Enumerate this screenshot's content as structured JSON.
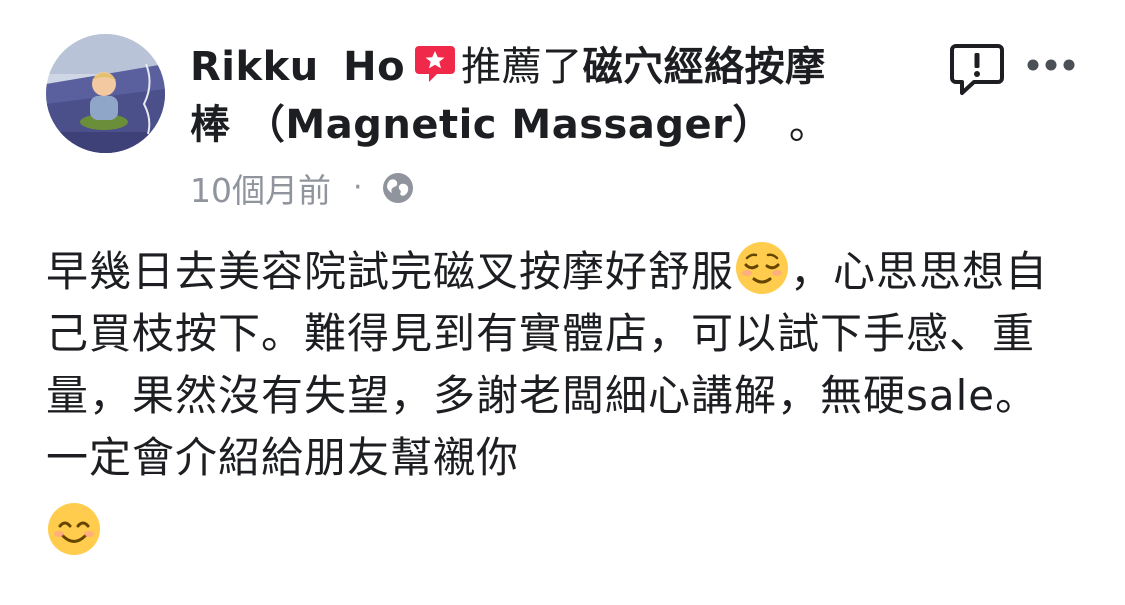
{
  "post": {
    "author": "Rikku  Ho",
    "action": "推薦了",
    "page_name_line1": "磁穴經絡按摩",
    "page_name_line2": "棒 （Magnetic Massager）",
    "trailing": "。",
    "timestamp": "10個月前",
    "separator": "·",
    "body": {
      "part1": "早幾日去美容院試完磁叉按摩好舒服",
      "emoji1": "relieved-face",
      "part2": "，心思思想自己買枝按下。難得見到有實體店，可以試下手感、重量，果然沒有失望，多謝老闆細心講解，無硬sale。一定會介紹給朋友幫襯你",
      "emoji2": "smiling-face"
    }
  },
  "icons": {
    "recommend": "recommend-badge-icon",
    "report": "report-icon",
    "more": "more-options-icon",
    "privacy": "globe-icon"
  },
  "colors": {
    "recommend_badge": "#f0284a",
    "meta_text": "#90949c",
    "text": "#1c1e21",
    "emoji_face": "#ffcc4d"
  }
}
